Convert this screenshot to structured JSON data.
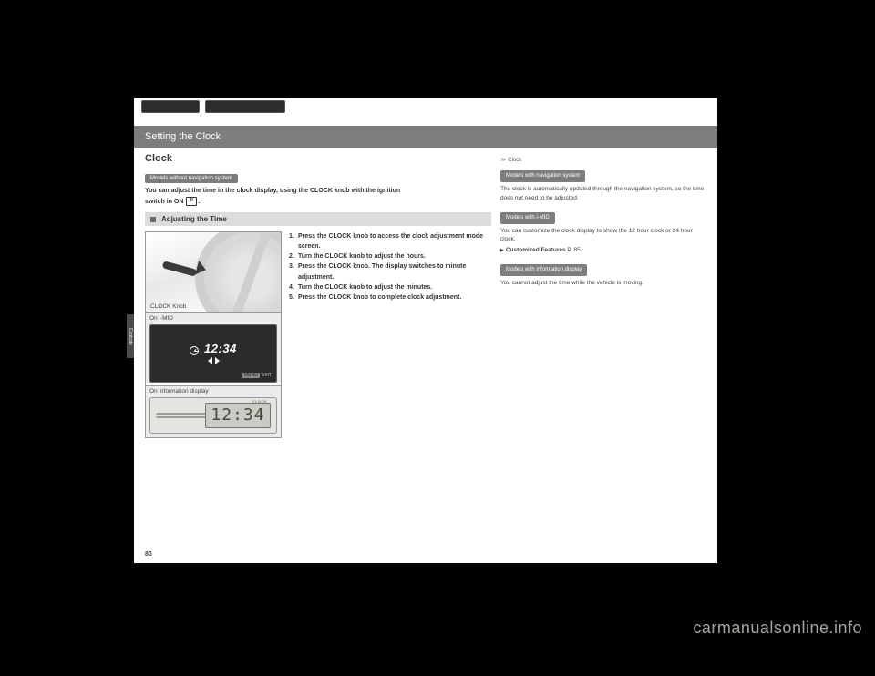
{
  "top_buttons": {
    "btn1": " ",
    "btn2": " "
  },
  "page_number": "80",
  "side_tab": "Controls",
  "header": {
    "title": "Setting the Clock"
  },
  "main": {
    "title": "Clock",
    "badge": "Models without navigation system",
    "intro_line1": "You can adjust the time in the clock display, using the CLOCK knob with the ignition",
    "intro_line2_pre": "switch in ON ",
    "intro_on": "II",
    "intro_line2_post": ".",
    "subhead": "Adjusting the Time",
    "steps": {
      "s1": {
        "n": "1.",
        "t": "Press the CLOCK knob to access the clock adjustment mode screen."
      },
      "s2": {
        "n": "2.",
        "t": "Turn the CLOCK knob to adjust the hours."
      },
      "s3": {
        "n": "3.",
        "t": "Press the CLOCK knob. The display switches to minute adjustment."
      },
      "s4": {
        "n": "4.",
        "t": "Turn the CLOCK knob to adjust the minutes."
      },
      "s5": {
        "n": "5.",
        "t": "Press the CLOCK knob to complete clock adjustment."
      }
    },
    "fig": {
      "label_a": "CLOCK Knob",
      "label_b": "On i-MID",
      "time_b": "12:34",
      "exit_b": "EXIT",
      "exit_tag": "MENU",
      "label_c": "On information display",
      "time_c": "12:34",
      "clock_c": "CLOCK"
    }
  },
  "annotations": {
    "head": "Clock",
    "b1": {
      "badge": "Models with navigation system",
      "p": "The clock is automatically updated through the navigation system, so the time does not need to be adjusted."
    },
    "b2": {
      "badge": "Models with i-MID",
      "p": "You can customize the clock display to show the 12 hour clock or 24 hour clock.",
      "link": "Customized Features",
      "pg": "P. 85"
    },
    "b3": {
      "badge": "Models with information display",
      "p": "You cannot adjust the time while the vehicle is moving."
    }
  },
  "watermark": "carmanualsonline.info"
}
